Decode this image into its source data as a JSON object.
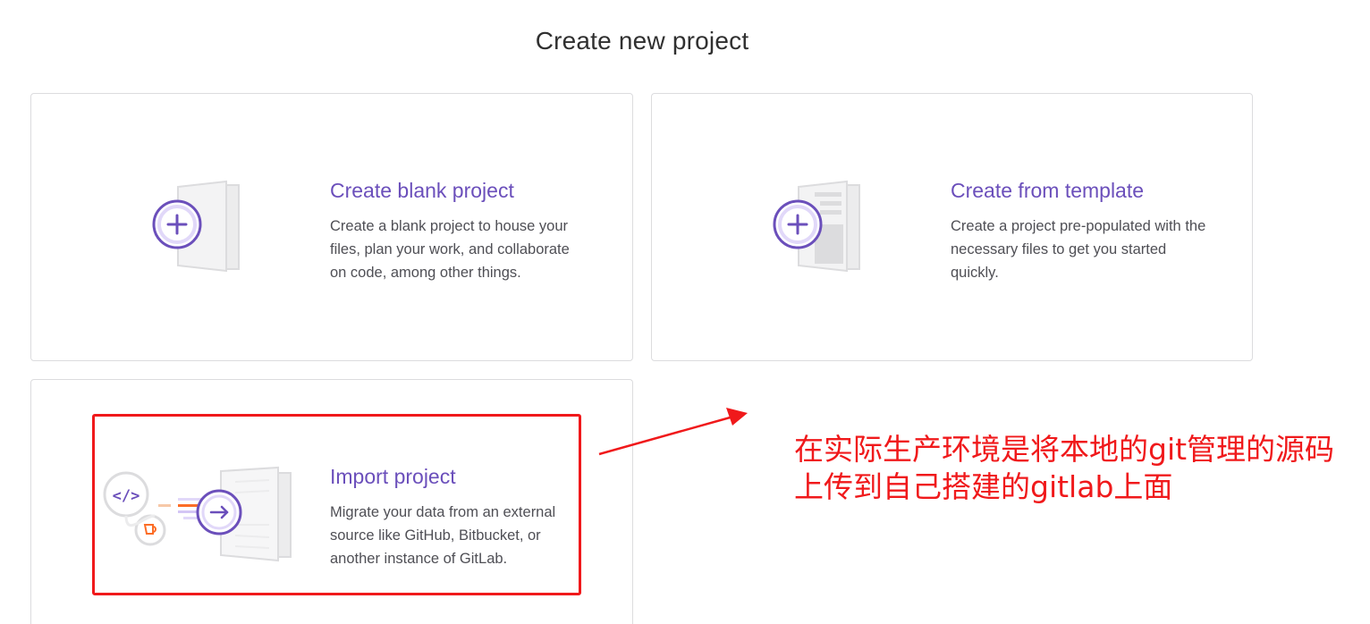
{
  "page": {
    "title": "Create new project"
  },
  "cards": [
    {
      "id": "blank",
      "title": "Create blank project",
      "description": "Create a blank project to house your files, plan your work, and collaborate on code, among other things.",
      "icon": "blank-project-icon"
    },
    {
      "id": "template",
      "title": "Create from template",
      "description": "Create a project pre-populated with the necessary files to get you started quickly.",
      "icon": "template-project-icon"
    },
    {
      "id": "import",
      "title": "Import project",
      "description": "Migrate your data from an external source like GitHub, Bitbucket, or another instance of GitLab.",
      "icon": "import-project-icon"
    }
  ],
  "annotation": {
    "line1": "在实际生产环境是将本地的git管理的源码",
    "line2": "上传到自己搭建的gitlab上面",
    "color": "#f0191b"
  },
  "colors": {
    "accent": "#6b4fbb",
    "border": "#dcdcde",
    "annotation_red": "#f0191b"
  }
}
